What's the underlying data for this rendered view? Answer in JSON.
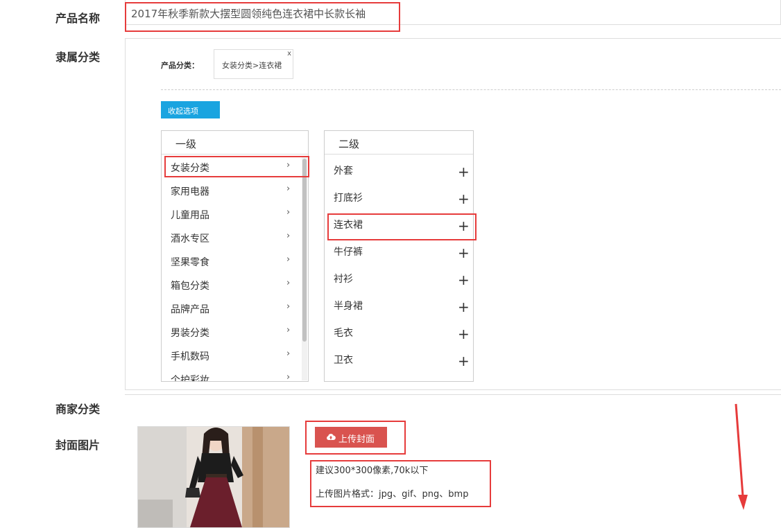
{
  "labels": {
    "product_name": "产品名称",
    "category": "隶属分类",
    "merchant_category": "商家分类",
    "cover_image": "封面图片"
  },
  "product_name_value": "2017年秋季新款大摆型圆领纯色连衣裙中长款长袖",
  "category_panel": {
    "product_category_label": "产品分类：",
    "selected_tag": "女装分类>连衣裙",
    "tag_close": "x",
    "collapse_button": "收起选项",
    "level1": {
      "title": "一级",
      "items": [
        "女装分类",
        "家用电器",
        "儿童用品",
        "酒水专区",
        "坚果零食",
        "箱包分类",
        "品牌产品",
        "男装分类",
        "手机数码",
        "个护彩妆"
      ],
      "arrow": "›"
    },
    "level2": {
      "title": "二级",
      "items": [
        "外套",
        "打底衫",
        "连衣裙",
        "牛仔裤",
        "衬衫",
        "半身裙",
        "毛衣",
        "卫衣"
      ],
      "plus": "+"
    }
  },
  "upload": {
    "button": "上传封面",
    "hint_size": "建议300*300像素,70k以下",
    "hint_format": "上传图片格式：jpg、gif、png、bmp"
  },
  "colors": {
    "accent_blue": "#1aa4e0",
    "upload_red": "#d9534f",
    "highlight_red": "#e63b3b"
  }
}
